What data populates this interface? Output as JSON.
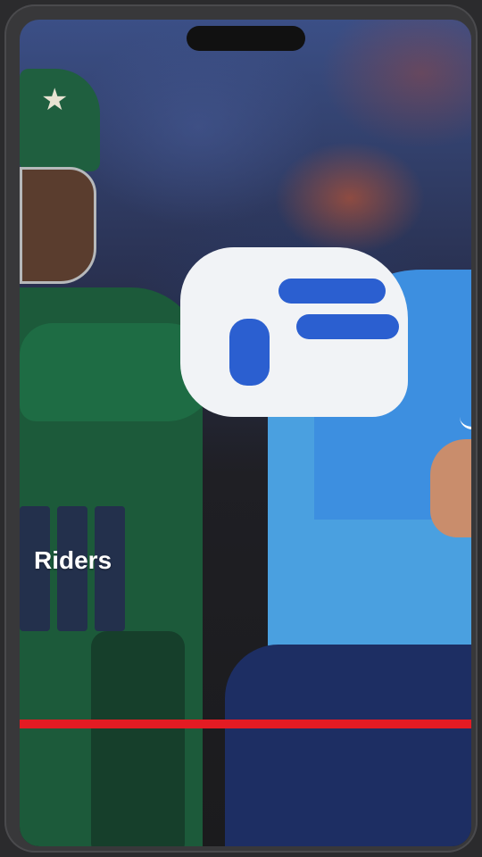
{
  "overlay": {
    "text": "Riders"
  },
  "progress": {
    "fraction": 1.0,
    "color": "#e31b23"
  },
  "icons": {
    "notch": "camera-notch",
    "jersey_logo": "swoosh-icon",
    "cap_badge": "star-icon"
  }
}
